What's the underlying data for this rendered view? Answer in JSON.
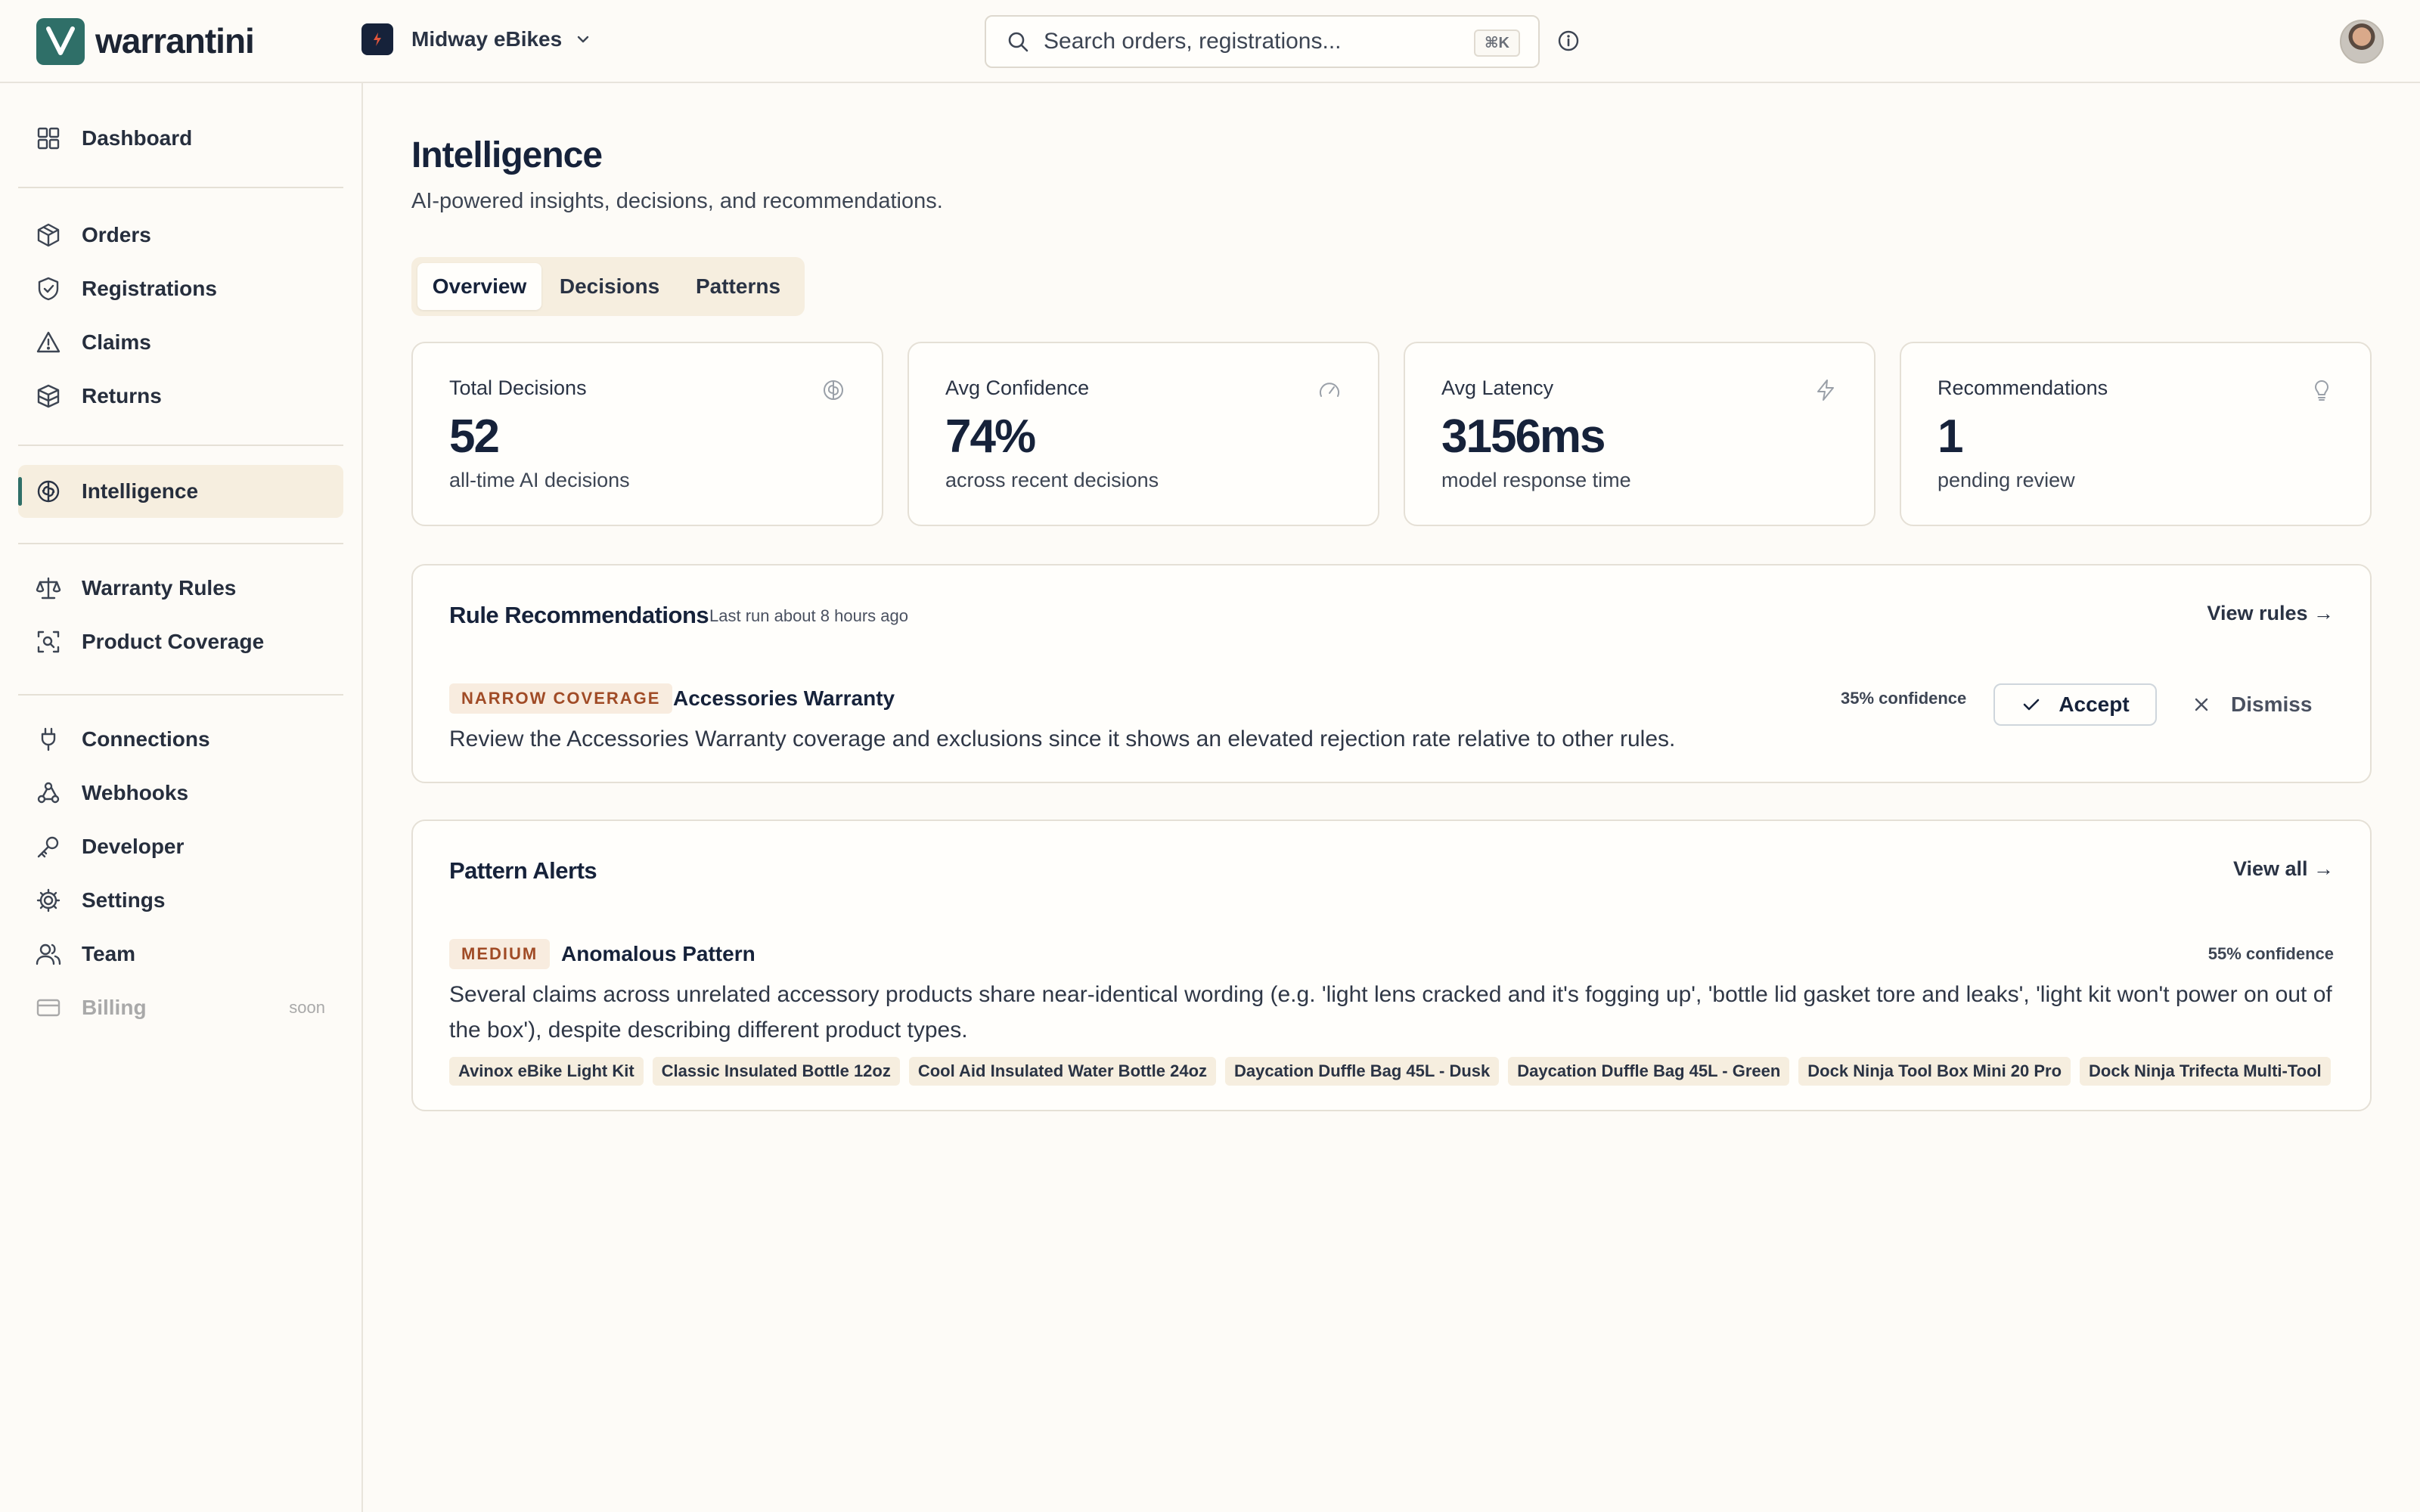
{
  "app": {
    "name": "warrantini"
  },
  "org": {
    "name": "Midway eBikes"
  },
  "search": {
    "placeholder": "Search orders, registrations...",
    "shortcut": "⌘K"
  },
  "sidebar": {
    "items": [
      {
        "label": "Dashboard",
        "icon": "grid-icon"
      },
      {
        "label": "Orders",
        "icon": "box-icon"
      },
      {
        "label": "Registrations",
        "icon": "shield-check-icon"
      },
      {
        "label": "Claims",
        "icon": "alert-triangle-icon"
      },
      {
        "label": "Returns",
        "icon": "package-icon"
      },
      {
        "label": "Intelligence",
        "icon": "brain-icon",
        "active": true
      },
      {
        "label": "Warranty Rules",
        "icon": "scale-icon"
      },
      {
        "label": "Product Coverage",
        "icon": "scan-search-icon"
      },
      {
        "label": "Connections",
        "icon": "plug-icon"
      },
      {
        "label": "Webhooks",
        "icon": "webhook-icon"
      },
      {
        "label": "Developer",
        "icon": "key-icon"
      },
      {
        "label": "Settings",
        "icon": "gear-icon"
      },
      {
        "label": "Team",
        "icon": "users-icon"
      },
      {
        "label": "Billing",
        "icon": "credit-card-icon",
        "disabled": true,
        "badge": "soon"
      }
    ]
  },
  "page": {
    "title": "Intelligence",
    "subtitle": "AI-powered insights, decisions, and recommendations."
  },
  "tabs": [
    {
      "label": "Overview",
      "active": true
    },
    {
      "label": "Decisions"
    },
    {
      "label": "Patterns"
    }
  ],
  "stats": [
    {
      "label": "Total Decisions",
      "value": "52",
      "desc": "all-time AI decisions",
      "icon": "brain-icon"
    },
    {
      "label": "Avg Confidence",
      "value": "74%",
      "desc": "across recent decisions",
      "icon": "gauge-icon"
    },
    {
      "label": "Avg Latency",
      "value": "3156ms",
      "desc": "model response time",
      "icon": "zap-icon"
    },
    {
      "label": "Recommendations",
      "value": "1",
      "desc": "pending review",
      "icon": "lightbulb-icon"
    }
  ],
  "recommendations": {
    "title": "Rule Recommendations",
    "meta": "Last run about 8 hours ago",
    "link": "View rules →",
    "items": [
      {
        "tag": "NARROW COVERAGE",
        "title": "Accessories Warranty",
        "confidence": "35% confidence",
        "body": "Review the Accessories Warranty coverage and exclusions since it shows an elevated rejection rate relative to other rules.",
        "accept_label": "Accept",
        "dismiss_label": "Dismiss"
      }
    ]
  },
  "patterns": {
    "title": "Pattern Alerts",
    "link": "View all →",
    "items": [
      {
        "tag": "MEDIUM",
        "title": "Anomalous Pattern",
        "confidence": "55% confidence",
        "body": "Several claims across unrelated accessory products share near-identical wording (e.g. 'light lens cracked and it's fogging up', 'bottle lid gasket tore and leaks', 'light kit won't power on out of the box'), despite describing different product types.",
        "products": [
          "Avinox eBike Light Kit",
          "Classic Insulated Bottle 12oz",
          "Cool Aid Insulated Water Bottle 24oz",
          "Daycation Duffle Bag 45L - Dusk",
          "Daycation Duffle Bag 45L - Green",
          "Dock Ninja Tool Box Mini 20 Pro",
          "Dock Ninja Trifecta Multi-Tool"
        ]
      }
    ]
  },
  "colors": {
    "accent": "#2f6f68",
    "tag_text": "#a04b26",
    "tag_bg": "#f8ecdf",
    "active_bg": "#f6eedf"
  }
}
